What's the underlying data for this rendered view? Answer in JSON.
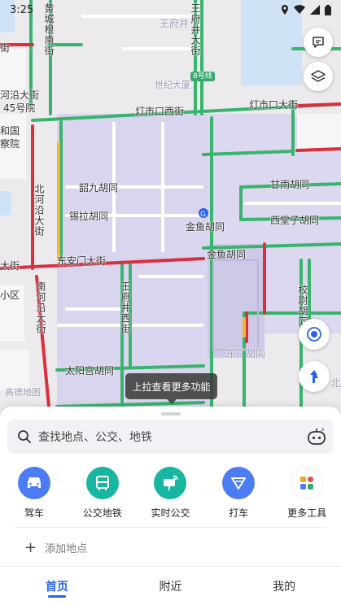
{
  "status_bar": {
    "time": "3:25"
  },
  "map": {
    "labels": {
      "huangchenggen_nanjie": "黄城根南街",
      "wangfujing_dajie_top": "王府井大街",
      "wangfujing_faint": "王府井",
      "guangchang_faint": "世纪大厦",
      "line8_badge": "8号线",
      "hevan_dajie": "河沿大街",
      "no45": "45号院",
      "jie_top": "街",
      "kemin_guo": "和国",
      "jiaoyuan": "察院",
      "dengshikou_xijie": "灯市口西街",
      "dengshikou_dajie": "灯市口大街",
      "ganyu_hutong": "甘雨胡同",
      "shaojiu_hutong": "韶九胡同",
      "xila_hutong": "锡拉胡同",
      "jinyu_hutong_metro": "金鱼胡同",
      "xitangzi_hutong": "西堂子胡同",
      "bei_he_yan": "北河沿大街",
      "dajie_left": "大街",
      "dongan_men_dajie": "东安门大街",
      "jinyu_hutong_road": "金鱼胡同",
      "xiaoqu": "小区",
      "nan_heyan_dajie": "南河沿大街",
      "wangfujing_xijie": "王府井西街",
      "xiaowei_hutong": "校尉胡同",
      "dongchang_hutong": "东厂胡同",
      "taijiechang_hutong": "太阳宫胡同",
      "gaode_logo": "高德地图",
      "bei_right": "北"
    }
  },
  "tooltip": "上拉查看更多功能",
  "search": {
    "placeholder": "查找地点、公交、地铁"
  },
  "quick_actions": [
    {
      "label": "驾车",
      "color": "#4c7cf3",
      "icon": "car-icon"
    },
    {
      "label": "公交地铁",
      "color": "#18b5a0",
      "icon": "bus-icon"
    },
    {
      "label": "实时公交",
      "color": "#18b5a0",
      "icon": "realtime-bus-icon"
    },
    {
      "label": "打车",
      "color": "#4c7cf3",
      "icon": "taxi-icon"
    },
    {
      "label": "更多工具",
      "color": "#ffffff",
      "icon": "apps-icon"
    }
  ],
  "add_place": "添加地点",
  "tabs": [
    {
      "label": "首页",
      "active": true
    },
    {
      "label": "附近",
      "active": false
    },
    {
      "label": "我的",
      "active": false
    }
  ]
}
